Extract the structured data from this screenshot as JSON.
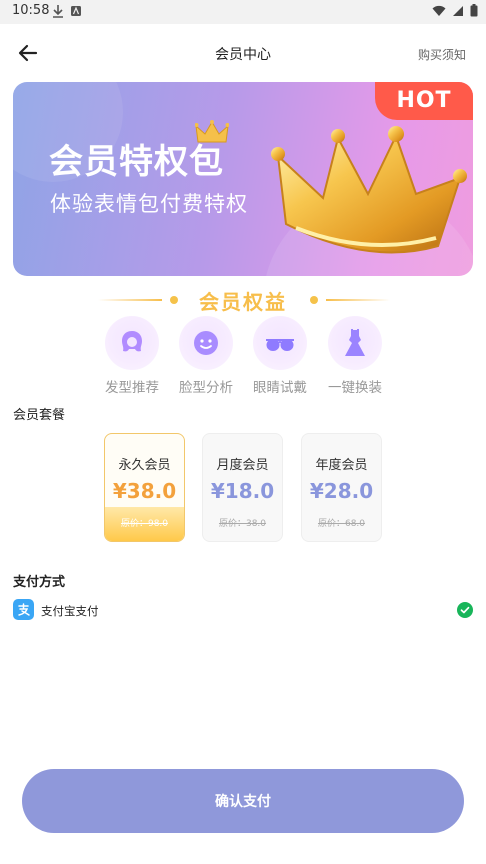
{
  "status_bar": {
    "time": "10:58"
  },
  "nav": {
    "title": "会员中心",
    "right_link": "购买须知"
  },
  "banner": {
    "title": "会员特权包",
    "subtitle": "体验表情包付费特权",
    "tag": "HOT"
  },
  "benefits": {
    "title": "会员权益",
    "items": [
      {
        "label": "发型推荐",
        "icon": "hairstyle-icon"
      },
      {
        "label": "脸型分析",
        "icon": "face-icon"
      },
      {
        "label": "眼睛试戴",
        "icon": "glasses-icon"
      },
      {
        "label": "一键换装",
        "icon": "dress-icon"
      }
    ]
  },
  "plans": {
    "label": "会员套餐",
    "items": [
      {
        "name": "永久会员",
        "price": "¥38.0",
        "original": "原价：98.0",
        "selected": true
      },
      {
        "name": "月度会员",
        "price": "¥18.0",
        "original": "原价：38.0",
        "selected": false
      },
      {
        "name": "年度会员",
        "price": "¥28.0",
        "original": "原价：68.0",
        "selected": false
      }
    ]
  },
  "payment": {
    "label": "支付方式",
    "method": "支付宝支付",
    "icon": "alipay-icon"
  },
  "confirm_button": "确认支付",
  "colors": {
    "accent": "#8f98da",
    "gold": "#f7be4b",
    "price_selected": "#f3a13c",
    "hot": "#ff5a4a"
  }
}
